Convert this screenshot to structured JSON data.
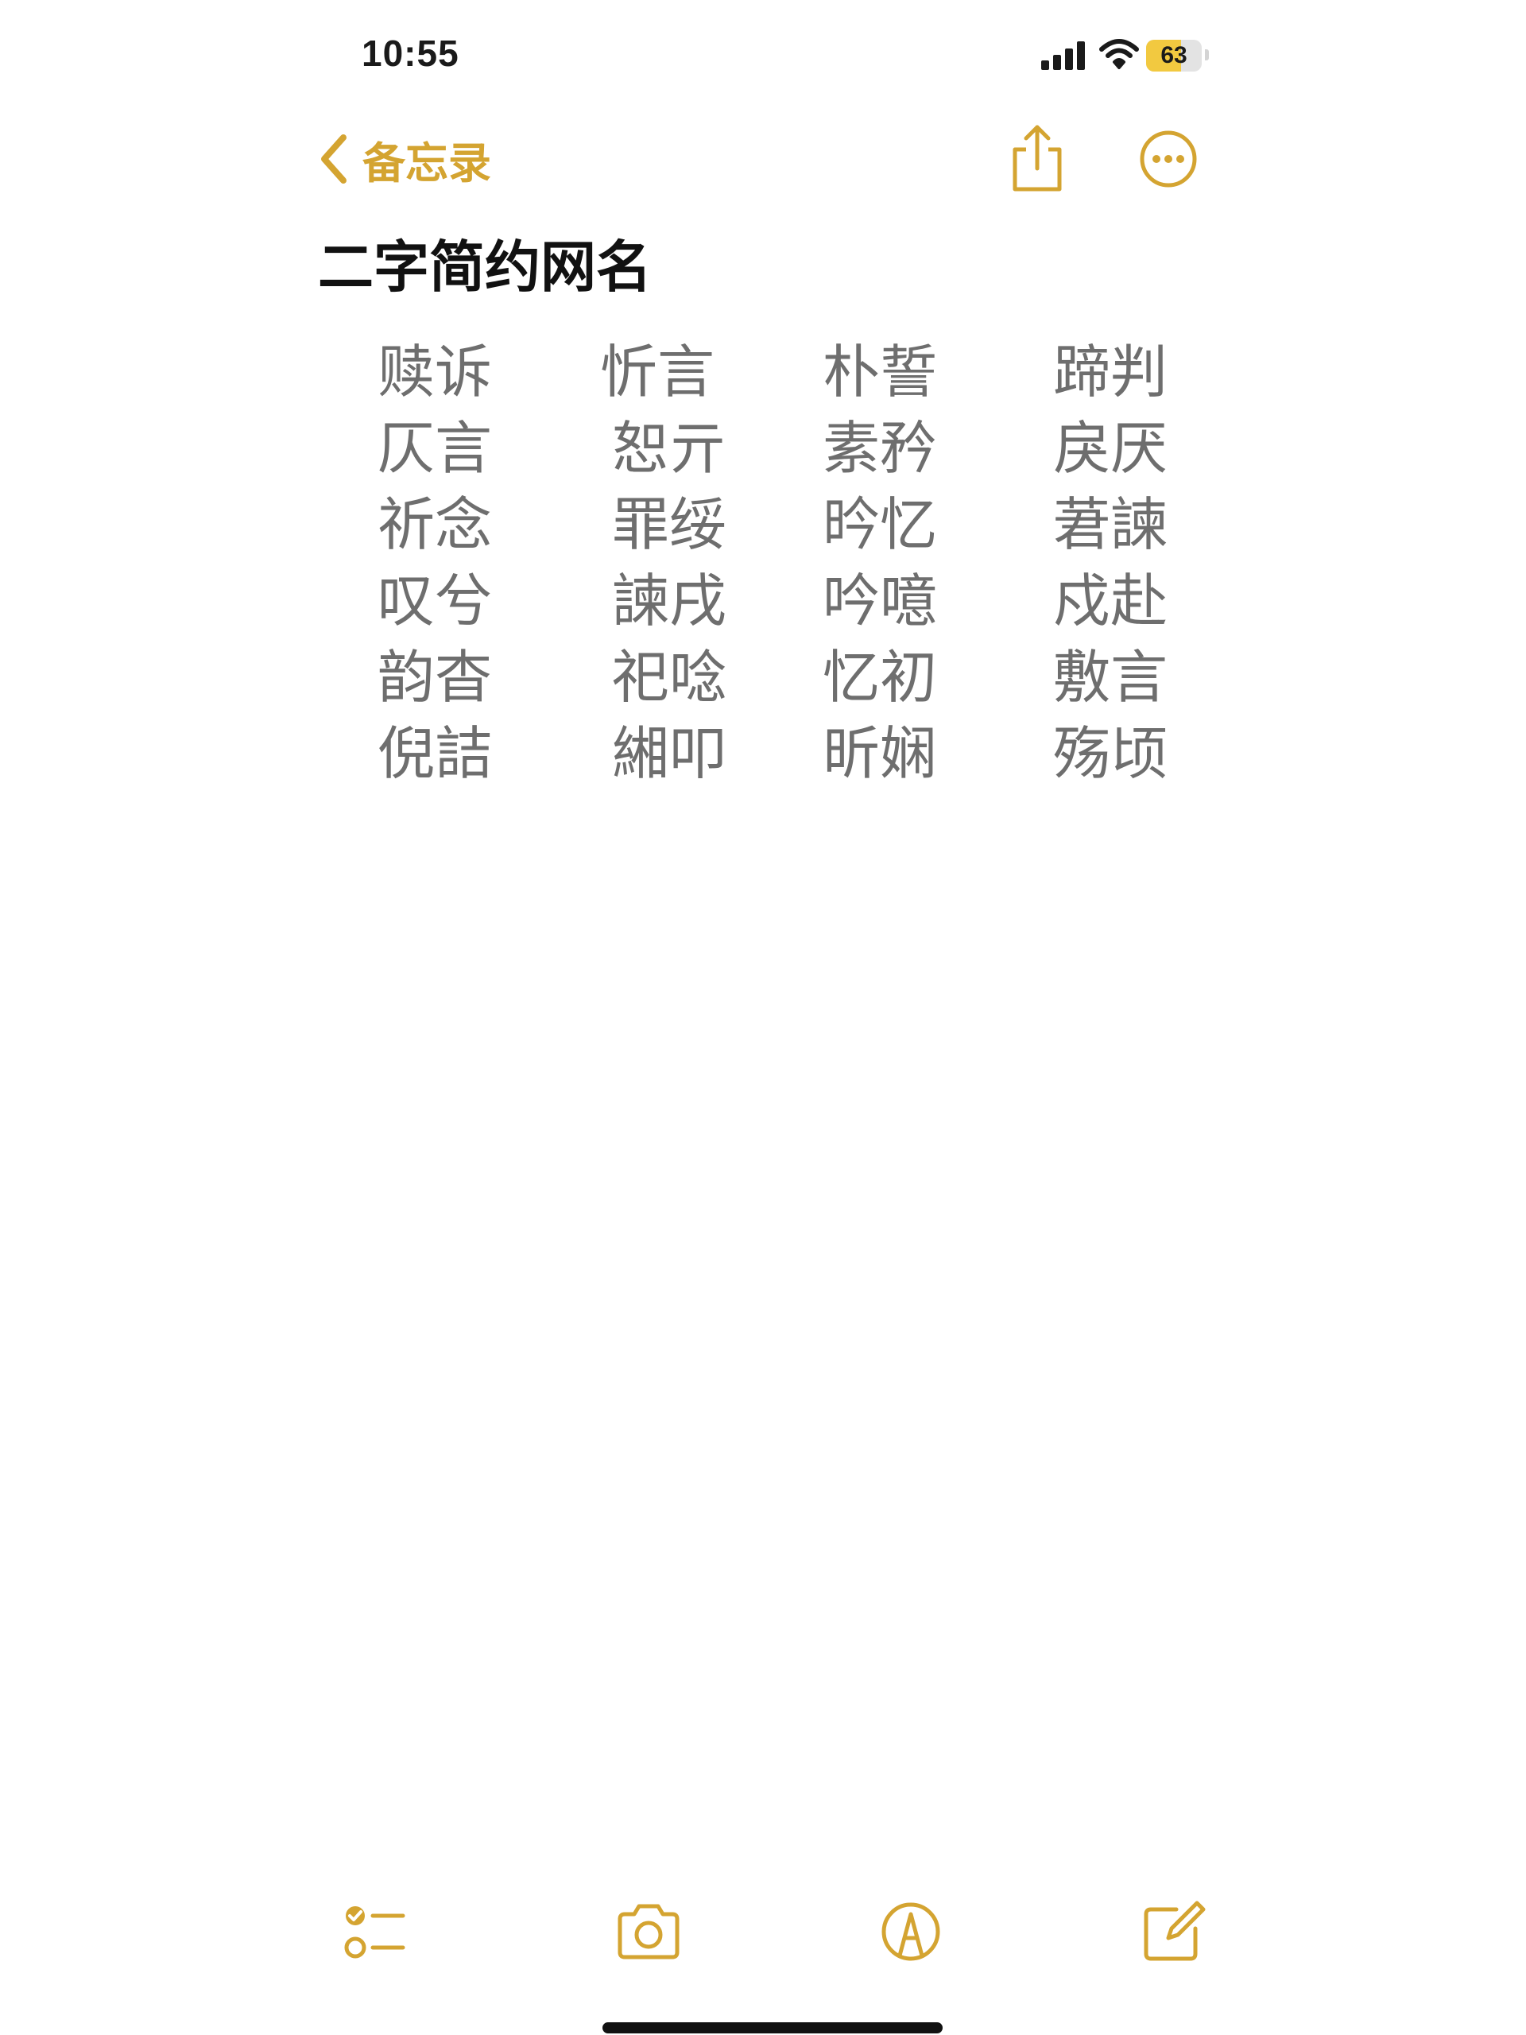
{
  "status_bar": {
    "time": "10:55",
    "battery_level": "63",
    "battery_fraction": 0.63,
    "icons": [
      "signal-icon",
      "wifi-icon",
      "battery-icon"
    ]
  },
  "nav": {
    "back_label": "备忘录",
    "accent_color": "#d4a431",
    "icons": [
      "chevron-left-icon",
      "share-icon",
      "more-icon"
    ]
  },
  "note": {
    "title": "二字简约网名",
    "rows": [
      [
        "赎诉",
        "忻言",
        "朴誓",
        "蹄判"
      ],
      [
        "仄言",
        "恕亓",
        "素矜",
        "戾厌"
      ],
      [
        "祈念",
        "罪绥",
        "昑忆",
        "莙諫"
      ],
      [
        "叹兮",
        "諫戌",
        "吟噫",
        "戍赴"
      ],
      [
        "韵杳",
        "祀唸",
        "忆初",
        "敷言"
      ],
      [
        "倪詰",
        "緗叩",
        "昕娴",
        "殇顷"
      ]
    ]
  },
  "toolbar": {
    "icons": [
      "checklist-icon",
      "camera-icon",
      "markup-icon",
      "compose-icon"
    ]
  }
}
